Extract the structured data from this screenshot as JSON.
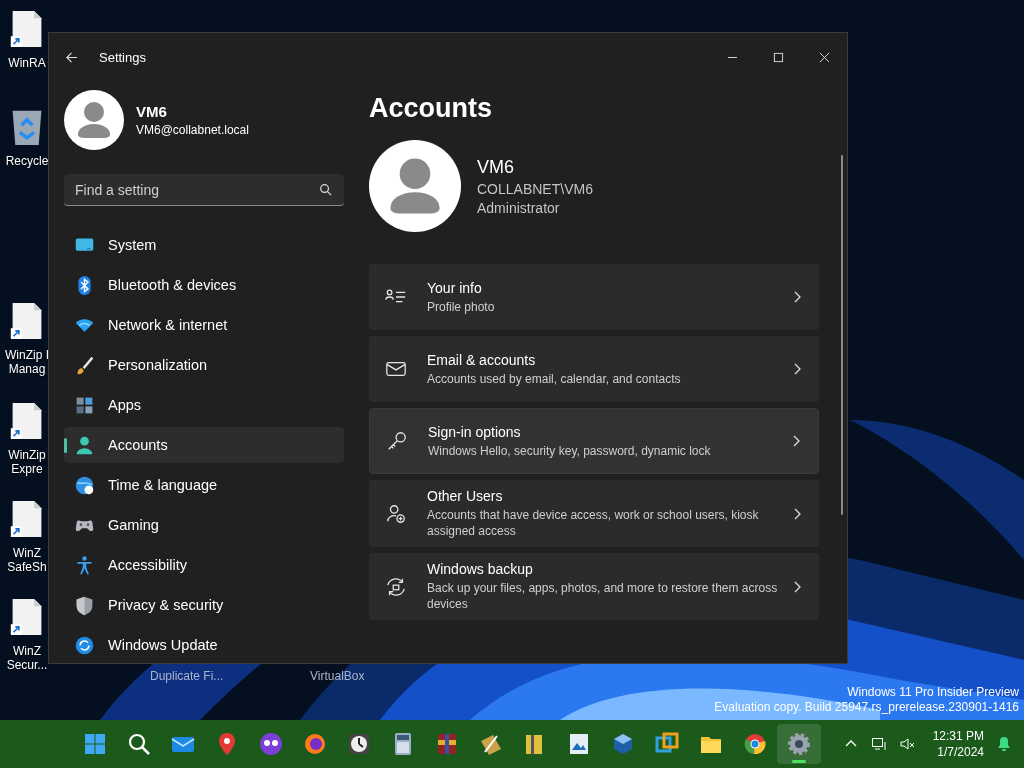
{
  "desktop_icons": [
    {
      "lines": [
        "WinRA"
      ]
    },
    {
      "lines": [
        "Recycle"
      ]
    },
    {
      "lines": [
        "WinZip I",
        "Manag"
      ]
    },
    {
      "lines": [
        "WinZip",
        "Expre"
      ]
    },
    {
      "lines": [
        "WinZ",
        "SafeSh"
      ]
    },
    {
      "lines": [
        "WinZ",
        "Secur..."
      ]
    }
  ],
  "desktop_labels": [
    "Duplicate Fi...",
    "VirtualBox"
  ],
  "evaluation_notice": [
    "Windows 11 Pro Insider Preview",
    "Evaluation copy. Build 25947.rs_prerelease.230901-1416"
  ],
  "window": {
    "title": "Settings",
    "user": {
      "name": "VM6",
      "email": "VM6@collabnet.local"
    },
    "search": {
      "placeholder": "Find a setting"
    },
    "nav": [
      {
        "label": "System",
        "selected": false
      },
      {
        "label": "Bluetooth & devices",
        "selected": false
      },
      {
        "label": "Network & internet",
        "selected": false
      },
      {
        "label": "Personalization",
        "selected": false
      },
      {
        "label": "Apps",
        "selected": false
      },
      {
        "label": "Accounts",
        "selected": true
      },
      {
        "label": "Time & language",
        "selected": false
      },
      {
        "label": "Gaming",
        "selected": false
      },
      {
        "label": "Accessibility",
        "selected": false
      },
      {
        "label": "Privacy & security",
        "selected": false
      },
      {
        "label": "Windows Update",
        "selected": false
      }
    ],
    "page": {
      "title": "Accounts",
      "account": {
        "name": "VM6",
        "domain": "COLLABNET\\VM6",
        "role": "Administrator"
      },
      "cards": [
        {
          "title": "Your info",
          "subtitle": "Profile photo",
          "hovered": false
        },
        {
          "title": "Email & accounts",
          "subtitle": "Accounts used by email, calendar, and contacts",
          "hovered": false
        },
        {
          "title": "Sign-in options",
          "subtitle": "Windows Hello, security key, password, dynamic lock",
          "hovered": true
        },
        {
          "title": "Other Users",
          "subtitle": "Accounts that have device access, work or school users, kiosk assigned access",
          "hovered": false
        },
        {
          "title": "Windows backup",
          "subtitle": "Back up your files, apps, photos, and more to restore them across devices",
          "hovered": false
        }
      ]
    }
  },
  "taskbar": {
    "apps": [
      {
        "running": false
      },
      {
        "running": false
      },
      {
        "running": false
      },
      {
        "running": false
      },
      {
        "running": false
      },
      {
        "running": false
      },
      {
        "running": false
      },
      {
        "running": false
      },
      {
        "running": false
      },
      {
        "running": false
      },
      {
        "running": false
      },
      {
        "running": false
      },
      {
        "running": false
      },
      {
        "running": false
      },
      {
        "running": false
      },
      {
        "running": false
      },
      {
        "running": true
      }
    ],
    "clock": {
      "time": "12:31 PM",
      "date": "1/7/2024"
    }
  }
}
